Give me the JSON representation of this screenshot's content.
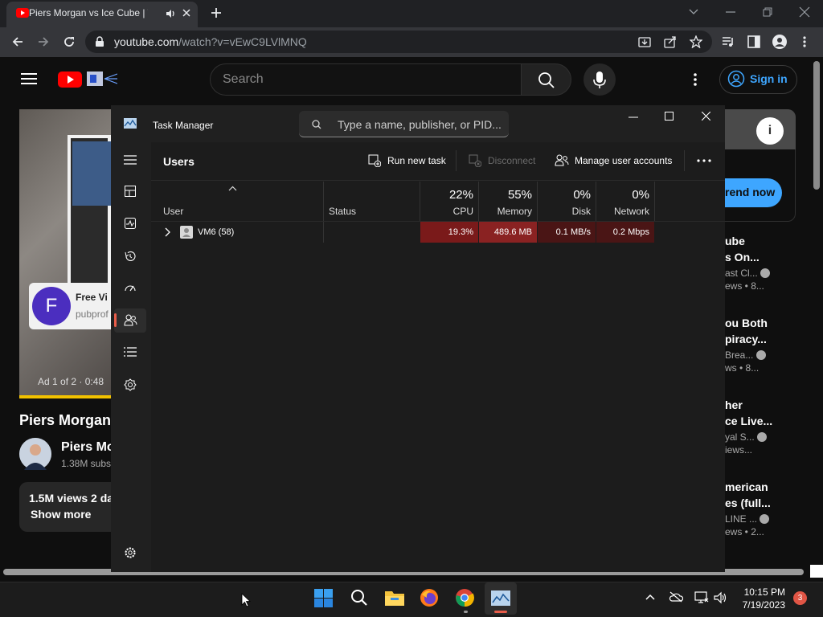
{
  "browser": {
    "tab_title": "Piers Morgan vs Ice Cube | T",
    "url_host": "youtube.com",
    "url_path": "/watch?v=vEwC9LVlMNQ"
  },
  "youtube": {
    "search_placeholder": "Search",
    "sign_in": "Sign in",
    "ad_avatar_letter": "F",
    "ad_name": "Free Vi",
    "ad_sub": "pubprof",
    "ad_count": "Ad 1 of 2 · 0:48",
    "video_title": "Piers Morgan",
    "channel_name": "Piers Mo",
    "channel_subs": "1.38M subs",
    "views": "1.5M views  2 da",
    "show_more": "Show more",
    "promo_button": "rend now",
    "recommendations": [
      {
        "title1": "ube",
        "title2": "s On...",
        "channel": "ast Cl...",
        "meta": "ews  • 8..."
      },
      {
        "title1": "ou Both",
        "title2": "piracy...",
        "channel": "Brea...",
        "meta": "ws  • 8..."
      },
      {
        "title1": "her",
        "title2": "ce Live...",
        "channel": "yal S...",
        "meta": "iews..."
      },
      {
        "title1": "merican",
        "title2": "es (full...",
        "channel": "LINE ...",
        "meta": "ews  • 2..."
      }
    ]
  },
  "task_manager": {
    "title": "Task Manager",
    "search_placeholder": "Type a name, publisher, or PID...",
    "page_heading": "Users",
    "commands": {
      "run_new_task": "Run new task",
      "disconnect": "Disconnect",
      "manage_accounts": "Manage user accounts"
    },
    "columns": {
      "user": "User",
      "status": "Status",
      "cpu_pct": "22%",
      "cpu_label": "CPU",
      "memory_pct": "55%",
      "memory_label": "Memory",
      "disk_pct": "0%",
      "disk_label": "Disk",
      "network_pct": "0%",
      "network_label": "Network"
    },
    "rows": [
      {
        "user": "VM6 (58)",
        "status": "",
        "cpu": "19.3%",
        "memory": "489.6 MB",
        "disk": "0.1 MB/s",
        "network": "0.2 Mbps"
      }
    ]
  },
  "taskbar": {
    "time": "10:15 PM",
    "date": "7/19/2023",
    "notification_count": "3"
  }
}
